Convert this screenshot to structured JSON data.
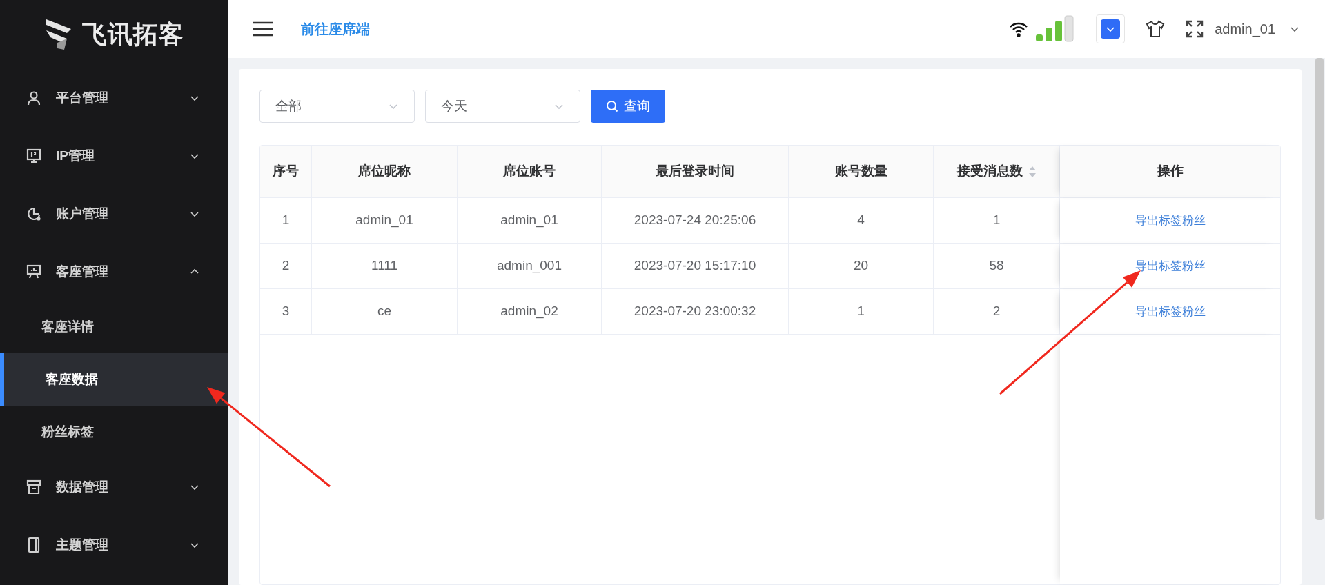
{
  "sidebar": {
    "logo": "飞讯拓客",
    "menus": [
      {
        "label": "平台管理",
        "expanded": false
      },
      {
        "label": "IP管理",
        "expanded": false
      },
      {
        "label": "账户管理",
        "expanded": false
      },
      {
        "label": "客座管理",
        "expanded": true,
        "children": [
          {
            "label": "客座详情",
            "selected": false
          },
          {
            "label": "客座数据",
            "selected": true
          },
          {
            "label": "粉丝标签",
            "selected": false
          }
        ]
      },
      {
        "label": "数据管理",
        "expanded": false
      },
      {
        "label": "主题管理",
        "expanded": false
      }
    ]
  },
  "header": {
    "link": "前往座席端",
    "user": "admin_01"
  },
  "filters": [
    {
      "value": "全部"
    },
    {
      "value": "今天"
    }
  ],
  "query_button": "查询",
  "table": {
    "columns": [
      {
        "label": "序号",
        "sortable": false
      },
      {
        "label": "席位昵称",
        "sortable": false
      },
      {
        "label": "席位账号",
        "sortable": false
      },
      {
        "label": "最后登录时间",
        "sortable": false
      },
      {
        "label": "账号数量",
        "sortable": false
      },
      {
        "label": "接受消息数",
        "sortable": true
      },
      {
        "label": "操作",
        "sortable": false
      }
    ],
    "rows": [
      {
        "cells": [
          "1",
          "admin_01",
          "admin_01",
          "2023-07-24 20:25:06",
          "4",
          "1"
        ],
        "action": "导出标签粉丝"
      },
      {
        "cells": [
          "2",
          "1111",
          "admin_001",
          "2023-07-20 15:17:10",
          "20",
          "58"
        ],
        "action": "导出标签粉丝"
      },
      {
        "cells": [
          "3",
          "ce",
          "admin_02",
          "2023-07-20 23:00:32",
          "1",
          "2"
        ],
        "action": "导出标签粉丝"
      }
    ]
  }
}
